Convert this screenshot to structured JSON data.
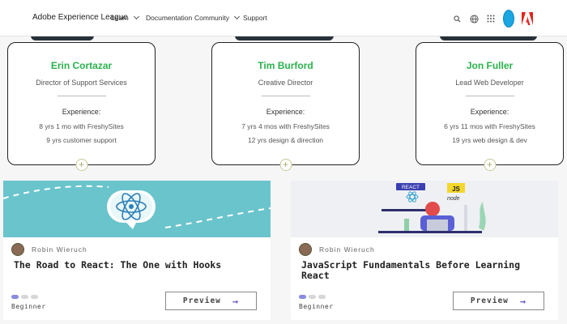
{
  "nav": {
    "brand": "Adobe Experience League",
    "links": [
      {
        "label": "Learn"
      },
      {
        "label": "Documentation"
      },
      {
        "label": "Community"
      },
      {
        "label": "Support"
      }
    ],
    "icons": [
      "search-icon",
      "globe-icon",
      "apps-grid-icon",
      "user-avatar",
      "adobe-logo-icon"
    ]
  },
  "team": [
    {
      "name": "Erin Cortazar",
      "role": "Director of Support Services",
      "exp_title": "Experience:",
      "exp1": "8 yrs 1 mo with FreshySites",
      "exp2": "9 yrs customer support"
    },
    {
      "name": "Tim Burford",
      "role": "Creative Director",
      "exp_title": "Experience:",
      "exp1": "7 yrs 4 mos with FreshySites",
      "exp2": "12 yrs design & direction"
    },
    {
      "name": "Jon Fuller",
      "role": "Lead Web Developer",
      "exp_title": "Experience:",
      "exp1": "6 yrs 11 mos with FreshySites",
      "exp2": "19 yrs web design & dev"
    }
  ],
  "courses": [
    {
      "author": "Robin Wieruch",
      "title": "The Road to React: The One with Hooks",
      "level": "Beginner",
      "preview": "Preview",
      "banner_labels": []
    },
    {
      "author": "Robin Wieruch",
      "title": "JavaScript Fundamentals Before Learning React",
      "level": "Beginner",
      "preview": "Preview",
      "banner_labels": [
        "REACT",
        "JS",
        "node"
      ]
    }
  ],
  "colors": {
    "accent_green": "#2bb24c",
    "preview_arrow": "#6b5fd0",
    "banner_teal": "#6ac4cc"
  }
}
